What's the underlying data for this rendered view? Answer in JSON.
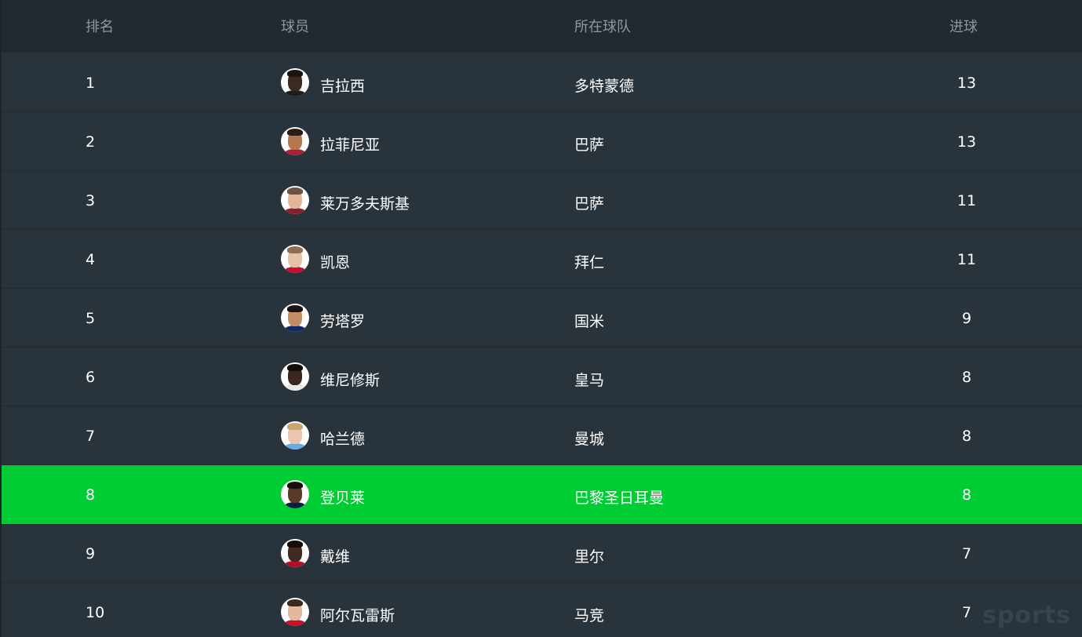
{
  "header": {
    "rank": "排名",
    "player": "球员",
    "team": "所在球队",
    "goals": "进球"
  },
  "rows": [
    {
      "rank": "1",
      "name": "吉拉西",
      "team": "多特蒙德",
      "goals": "13",
      "avatar": "player-avatar-icon",
      "skin": "#3b2a22",
      "hair": "#1a1310",
      "kit": "#1e1e1e"
    },
    {
      "rank": "2",
      "name": "拉菲尼亚",
      "team": "巴萨",
      "goals": "13",
      "avatar": "player-avatar-icon",
      "skin": "#b4784f",
      "hair": "#2b1d14",
      "kit": "#b01f3a"
    },
    {
      "rank": "3",
      "name": "莱万多夫斯基",
      "team": "巴萨",
      "goals": "11",
      "avatar": "player-avatar-icon",
      "skin": "#e3b69a",
      "hair": "#6a5443",
      "kit": "#8a1f2e"
    },
    {
      "rank": "4",
      "name": "凯恩",
      "team": "拜仁",
      "goals": "11",
      "avatar": "player-avatar-icon",
      "skin": "#e6c2a6",
      "hair": "#8e6f52",
      "kit": "#c8102e"
    },
    {
      "rank": "5",
      "name": "劳塔罗",
      "team": "国米",
      "goals": "9",
      "avatar": "player-avatar-icon",
      "skin": "#c38d66",
      "hair": "#1b1410",
      "kit": "#0d2b66"
    },
    {
      "rank": "6",
      "name": "维尼修斯",
      "team": "皇马",
      "goals": "8",
      "avatar": "player-avatar-icon",
      "skin": "#3a271e",
      "hair": "#120c09",
      "kit": "#e9e9e9"
    },
    {
      "rank": "7",
      "name": "哈兰德",
      "team": "曼城",
      "goals": "8",
      "avatar": "player-avatar-icon",
      "skin": "#e9c6ad",
      "hair": "#c9a66b",
      "kit": "#6cabdd"
    },
    {
      "rank": "8",
      "name": "登贝莱",
      "team": "巴黎圣日耳曼",
      "goals": "8",
      "avatar": "player-avatar-icon",
      "skin": "#5b3a2a",
      "hair": "#1a110c",
      "kit": "#0b1f45",
      "highlight": true
    },
    {
      "rank": "9",
      "name": "戴维",
      "team": "里尔",
      "goals": "7",
      "avatar": "player-avatar-icon",
      "skin": "#3f2a20",
      "hair": "#140d0a",
      "kit": "#b00f25"
    },
    {
      "rank": "10",
      "name": "阿尔瓦雷斯",
      "team": "马竞",
      "goals": "7",
      "avatar": "player-avatar-icon",
      "skin": "#e2b99c",
      "hair": "#3a2a20",
      "kit": "#c8102e"
    }
  ],
  "watermark": "sports",
  "colors": {
    "background": "#29333b",
    "header": "#222a31",
    "highlight": "#00cc33",
    "text": "#ffffff",
    "header_text": "#8d979e"
  }
}
